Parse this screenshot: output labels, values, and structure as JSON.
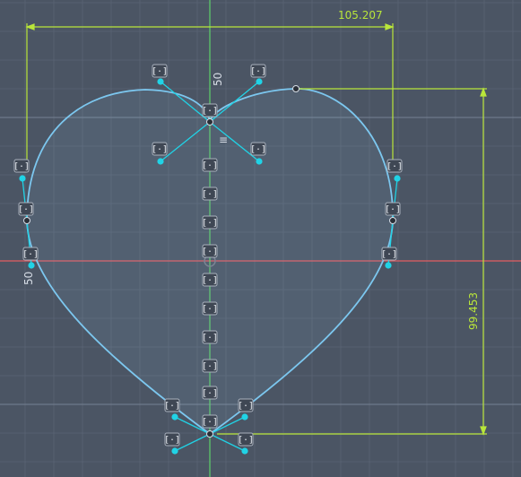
{
  "viewport": {
    "background": "#4b5564",
    "grid_minor": "#5a6474",
    "grid_major": "#768193",
    "x_axis_color": "#e35d62",
    "y_axis_color": "#5ed06a",
    "curve_color": "#7cc7ef",
    "handle_color": "#20d3e6",
    "dimension_color": "#b9e63a"
  },
  "dimensions": {
    "width": "105.207",
    "height": "99.453",
    "center_top": "50",
    "center_left": "50"
  },
  "constraint_glyph": "[·]"
}
